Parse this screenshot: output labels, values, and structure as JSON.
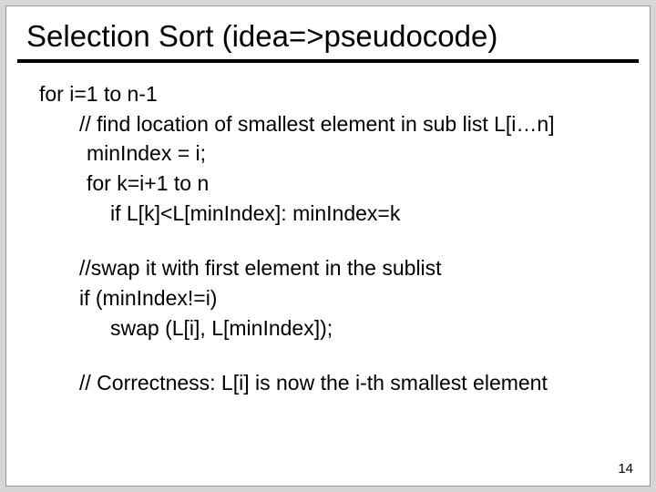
{
  "title": "Selection Sort (idea=>pseudocode)",
  "lines": {
    "l0": "for i=1 to n-1",
    "l1": "// find location of smallest element in sub list L[i…n]",
    "l2": "minIndex = i;",
    "l3": "for k=i+1 to n",
    "l4": "if L[k]<L[minIndex]: minIndex=k",
    "l5": "//swap it with first element in the sublist",
    "l6": "if (minIndex!=i)",
    "l7": "swap (L[i], L[minIndex]);",
    "l8": "// Correctness: L[i] is now the i-th smallest element"
  },
  "pagenum": "14"
}
